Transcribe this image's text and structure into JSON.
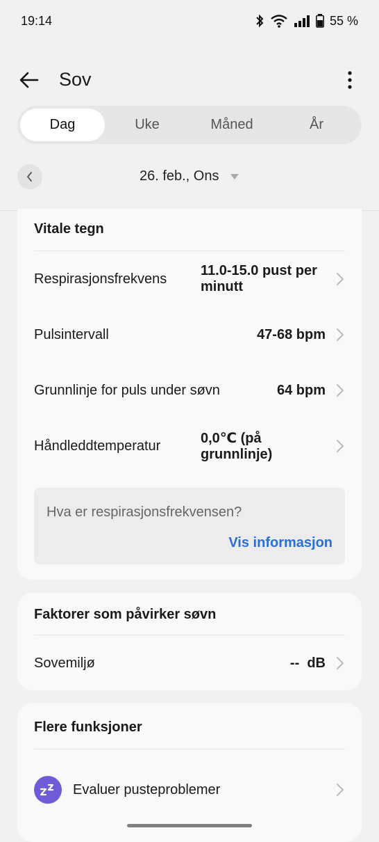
{
  "status": {
    "time": "19:14",
    "battery": "55 %"
  },
  "header": {
    "title": "Sov"
  },
  "tabs": [
    {
      "label": "Dag",
      "active": true
    },
    {
      "label": "Uke",
      "active": false
    },
    {
      "label": "Måned",
      "active": false
    },
    {
      "label": "År",
      "active": false
    }
  ],
  "date": {
    "label": "26. feb., Ons"
  },
  "vitals": {
    "title": "Vitale tegn",
    "rows": [
      {
        "label": "Respirasjonsfrekvens",
        "value": "11.0-15.0 pust per minutt"
      },
      {
        "label": "Pulsintervall",
        "value": "47-68 bpm"
      },
      {
        "label": "Grunnlinje for puls under søvn",
        "value": "64 bpm"
      },
      {
        "label": "Håndleddtemperatur",
        "value": "0,0℃ (på grunnlinje)"
      }
    ],
    "info": {
      "question": "Hva er respirasjonsfrekvensen?",
      "link": "Vis informasjon"
    }
  },
  "factors": {
    "title": "Faktorer som påvirker søvn",
    "rows": [
      {
        "label": "Sovemiljø",
        "value": "--  dB"
      }
    ]
  },
  "more": {
    "title": "Flere funksjoner",
    "rows": [
      {
        "label": "Evaluer pusteproblemer",
        "icon": "zzz-icon"
      }
    ]
  },
  "colors": {
    "accent": "#2b6fd6",
    "icon_bg": "#6f5bd6"
  }
}
